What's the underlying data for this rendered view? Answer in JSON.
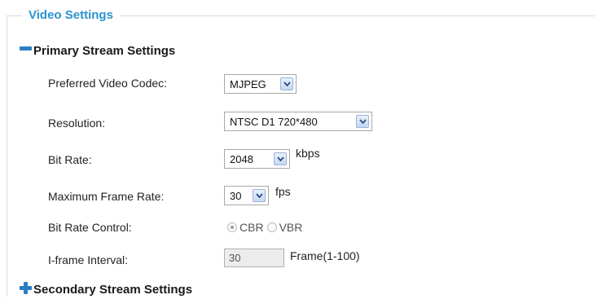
{
  "fieldset": {
    "legend": "Video Settings"
  },
  "primary": {
    "header": "Primary Stream Settings",
    "codec": {
      "label": "Preferred Video Codec:",
      "value": "MJPEG"
    },
    "resolution": {
      "label": "Resolution:",
      "value": "NTSC D1 720*480"
    },
    "bitrate": {
      "label": "Bit Rate:",
      "value": "2048",
      "unit": "kbps"
    },
    "framerate": {
      "label": "Maximum Frame Rate:",
      "value": "30",
      "unit": "fps"
    },
    "bitrate_control": {
      "label": "Bit Rate Control:",
      "options": [
        "CBR",
        "VBR"
      ],
      "selected": "CBR"
    },
    "iframe": {
      "label": "I-frame Interval:",
      "value": "30",
      "unit": "Frame(1-100)"
    }
  },
  "secondary": {
    "header": "Secondary Stream Settings"
  },
  "colors": {
    "legend": "#2a93cf",
    "icon": "#2d7cc4"
  }
}
